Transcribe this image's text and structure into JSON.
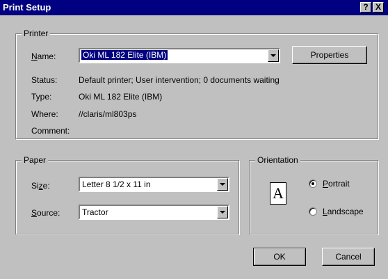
{
  "window": {
    "title": "Print Setup",
    "help_btn": "?",
    "close_btn": "X"
  },
  "printer": {
    "legend": "Printer",
    "name_label": "Name:",
    "name_value": "Oki ML 182 Elite (IBM)",
    "properties_button": "Properties",
    "status_label": "Status:",
    "status_value": "Default printer; User intervention; 0 documents waiting",
    "type_label": "Type:",
    "type_value": "Oki ML 182 Elite (IBM)",
    "where_label": "Where:",
    "where_value": "//claris/ml803ps",
    "comment_label": "Comment:"
  },
  "paper": {
    "legend": "Paper",
    "size_label": "Size:",
    "size_value": "Letter 8 1/2 x 11 in",
    "source_label": "Source:",
    "source_value": "Tractor"
  },
  "orientation": {
    "legend": "Orientation",
    "icon_letter": "A",
    "portrait_label": "Portrait",
    "landscape_label": "Landscape",
    "selected": "Portrait"
  },
  "buttons": {
    "ok": "OK",
    "cancel": "Cancel"
  }
}
